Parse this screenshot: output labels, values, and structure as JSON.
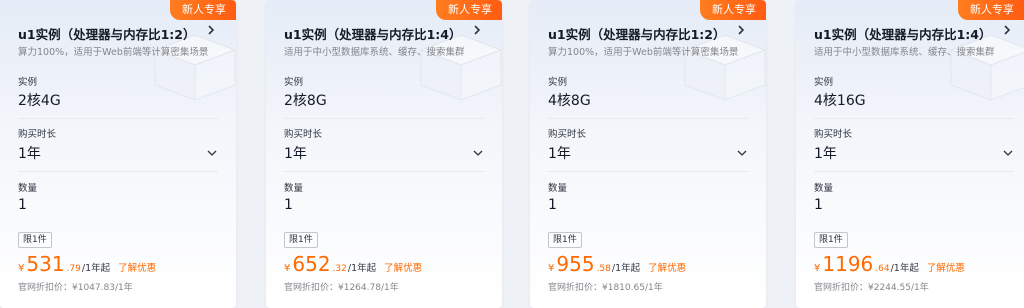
{
  "cards": [
    {
      "badge": "新人专享",
      "title": "u1实例（处理器与内存比1:2）",
      "desc": "算力100%，适用于Web前端等计算密集场景",
      "instance_label": "实例",
      "instance_value": "2核4G",
      "duration_label": "购买时长",
      "duration_value": "1年",
      "qty_label": "数量",
      "qty_value": "1",
      "limit": "限1件",
      "currency": "¥",
      "price_int": "531",
      "price_dec": ".79",
      "price_unit": "/1年起",
      "discount_link": "了解优惠",
      "orig_price": "官网折扣价：¥1047.83/1年"
    },
    {
      "badge": "新人专享",
      "title": "u1实例（处理器与内存比1:4）",
      "desc": "适用于中小型数据库系统、缓存、搜索集群",
      "instance_label": "实例",
      "instance_value": "2核8G",
      "duration_label": "购买时长",
      "duration_value": "1年",
      "qty_label": "数量",
      "qty_value": "1",
      "limit": "限1件",
      "currency": "¥",
      "price_int": "652",
      "price_dec": ".32",
      "price_unit": "/1年起",
      "discount_link": "了解优惠",
      "orig_price": "官网折扣价：¥1264.78/1年"
    },
    {
      "badge": "新人专享",
      "title": "u1实例（处理器与内存比1:2）",
      "desc": "算力100%，适用于Web前端等计算密集场景",
      "instance_label": "实例",
      "instance_value": "4核8G",
      "duration_label": "购买时长",
      "duration_value": "1年",
      "qty_label": "数量",
      "qty_value": "1",
      "limit": "限1件",
      "currency": "¥",
      "price_int": "955",
      "price_dec": ".58",
      "price_unit": "/1年起",
      "discount_link": "了解优惠",
      "orig_price": "官网折扣价：¥1810.65/1年"
    },
    {
      "badge": "新人专享",
      "title": "u1实例（处理器与内存比1:4）",
      "desc": "适用于中小型数据库系统、缓存、搜索集群",
      "instance_label": "实例",
      "instance_value": "4核16G",
      "duration_label": "购买时长",
      "duration_value": "1年",
      "qty_label": "数量",
      "qty_value": "1",
      "limit": "限1件",
      "currency": "¥",
      "price_int": "1196",
      "price_dec": ".64",
      "price_unit": "/1年起",
      "discount_link": "了解优惠",
      "orig_price": "官网折扣价：¥2244.55/1年"
    }
  ],
  "colors": {
    "accent": "#ff6a00",
    "badge": "#ff7d1f",
    "text_primary": "#151b26",
    "text_secondary": "#84868c"
  },
  "icons": {
    "header_arrow": "chevron-right-icon",
    "select_arrow": "chevron-down-icon",
    "decoration": "server-box-illustration"
  }
}
